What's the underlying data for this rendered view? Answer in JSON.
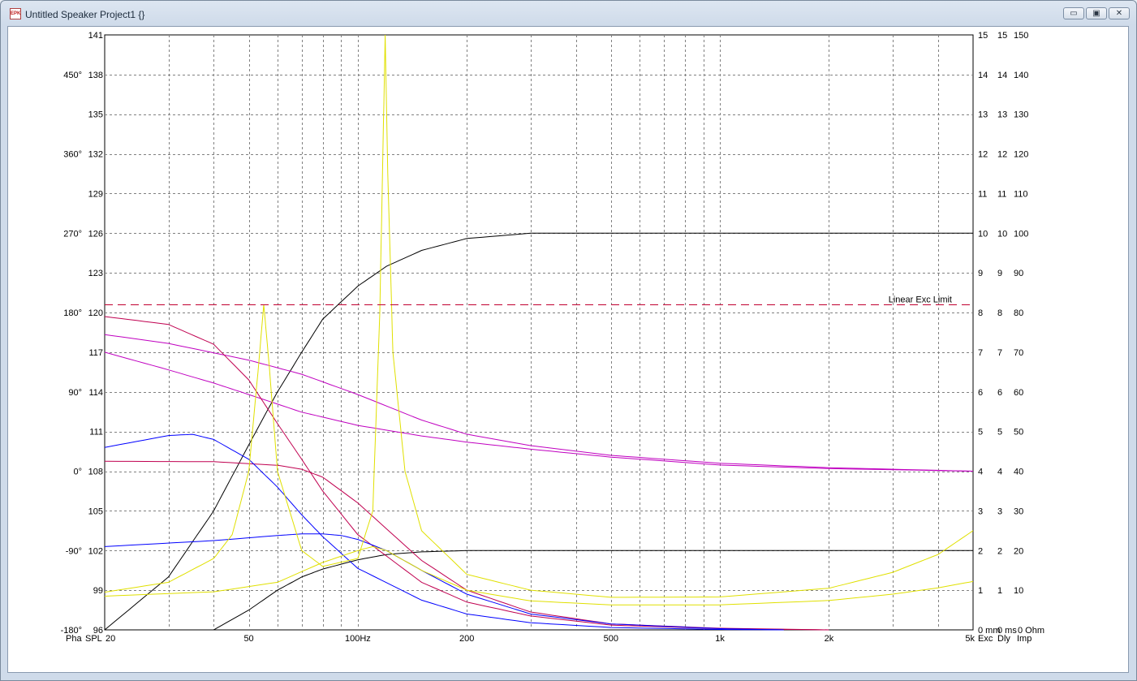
{
  "window": {
    "title": "Untitled Speaker Project1 {}",
    "app_icon_text": "EPK",
    "minimize_glyph": "▭",
    "maximize_glyph": "▣",
    "close_glyph": "✕"
  },
  "chart_data": {
    "type": "line",
    "x_axis": {
      "scale": "log",
      "range": [
        20,
        5000
      ],
      "tick_labels": [
        {
          "value": 20,
          "label": "20"
        },
        {
          "value": 50,
          "label": "50"
        },
        {
          "value": 100,
          "label": "100Hz"
        },
        {
          "value": 200,
          "label": "200"
        },
        {
          "value": 500,
          "label": "500"
        },
        {
          "value": 1000,
          "label": "1k"
        },
        {
          "value": 2000,
          "label": "2k"
        },
        {
          "value": 5000,
          "label": "5k"
        }
      ],
      "minor_gridlines": [
        30,
        40,
        60,
        70,
        80,
        90,
        300,
        400,
        600,
        700,
        800,
        900,
        3000,
        4000
      ]
    },
    "left_axes": {
      "phase_labels": [
        "450°",
        "360°",
        "270°",
        "180°",
        "90°",
        "0°",
        "-90°",
        "-180°"
      ],
      "spl_range": [
        96,
        141
      ],
      "spl_labels": [
        "141",
        "138",
        "135",
        "132",
        "129",
        "126",
        "123",
        "120",
        "117",
        "114",
        "111",
        "108",
        "105",
        "102",
        "99",
        "96"
      ]
    },
    "right_axes": {
      "excursion_labels": [
        "15",
        "14",
        "13",
        "12",
        "11",
        "10",
        "9",
        "8",
        "7",
        "6",
        "5",
        "4",
        "3",
        "2",
        "1",
        "0 mm"
      ],
      "delay_labels": [
        "15",
        "14",
        "13",
        "12",
        "11",
        "10",
        "9",
        "8",
        "7",
        "6",
        "5",
        "4",
        "3",
        "2",
        "1",
        "0 ms"
      ],
      "impedance_labels": [
        "150",
        "140",
        "130",
        "120",
        "110",
        "100",
        "90",
        "80",
        "70",
        "60",
        "50",
        "40",
        "30",
        "20",
        "10",
        "0 Ohm"
      ]
    },
    "legend": {
      "pha": {
        "label": "Pha",
        "color": "#c000c0"
      },
      "spl": {
        "label": "SPL",
        "color": "#000000"
      },
      "exc": {
        "label": "Exc",
        "color": "#c00050"
      },
      "dly": {
        "label": "Dly",
        "color": "#0000ff"
      },
      "imp": {
        "label": "Imp",
        "color": "#e0e000"
      }
    },
    "annotation": {
      "label": "Linear Exc Limit",
      "value_mm": 8.2,
      "color": "#c00030"
    },
    "series": [
      {
        "kind": "spl",
        "color": "#000000",
        "unit": "dB",
        "points": [
          [
            20,
            96
          ],
          [
            30,
            100
          ],
          [
            40,
            105
          ],
          [
            50,
            110
          ],
          [
            60,
            114
          ],
          [
            70,
            117
          ],
          [
            80,
            119.5
          ],
          [
            100,
            122
          ],
          [
            120,
            123.5
          ],
          [
            150,
            124.7
          ],
          [
            200,
            125.6
          ],
          [
            300,
            126
          ],
          [
            5000,
            126
          ]
        ]
      },
      {
        "kind": "spl",
        "color": "#000000",
        "unit": "dB",
        "points": [
          [
            40,
            96
          ],
          [
            50,
            97.5
          ],
          [
            60,
            99
          ],
          [
            70,
            100
          ],
          [
            80,
            100.6
          ],
          [
            100,
            101.3
          ],
          [
            120,
            101.7
          ],
          [
            150,
            101.9
          ],
          [
            200,
            102
          ],
          [
            5000,
            102
          ]
        ]
      },
      {
        "kind": "phase",
        "color": "#c000c0",
        "unit": "deg",
        "points": [
          [
            20,
            155
          ],
          [
            30,
            145
          ],
          [
            50,
            126
          ],
          [
            70,
            110
          ],
          [
            100,
            87
          ],
          [
            150,
            58
          ],
          [
            200,
            42
          ],
          [
            300,
            29
          ],
          [
            500,
            18
          ],
          [
            1000,
            9
          ],
          [
            2000,
            4
          ],
          [
            5000,
            0
          ]
        ]
      },
      {
        "kind": "phase",
        "color": "#c000c0",
        "unit": "deg",
        "points": [
          [
            20,
            135
          ],
          [
            30,
            115
          ],
          [
            40,
            100
          ],
          [
            50,
            87
          ],
          [
            70,
            67
          ],
          [
            100,
            52
          ],
          [
            150,
            40
          ],
          [
            200,
            33
          ],
          [
            300,
            25
          ],
          [
            500,
            16
          ],
          [
            1000,
            7
          ],
          [
            2000,
            3
          ],
          [
            5000,
            0
          ]
        ]
      },
      {
        "kind": "excursion",
        "color": "#c00050",
        "unit": "mm",
        "points": [
          [
            20,
            7.9
          ],
          [
            30,
            7.7
          ],
          [
            40,
            7.2
          ],
          [
            50,
            6.3
          ],
          [
            60,
            5.2
          ],
          [
            70,
            4.3
          ],
          [
            80,
            3.5
          ],
          [
            100,
            2.4
          ],
          [
            150,
            1.2
          ],
          [
            200,
            0.7
          ],
          [
            300,
            0.35
          ],
          [
            500,
            0.12
          ],
          [
            1000,
            0.03
          ],
          [
            2000,
            0
          ]
        ]
      },
      {
        "kind": "excursion",
        "color": "#c00050",
        "unit": "mm",
        "points": [
          [
            20,
            4.25
          ],
          [
            40,
            4.24
          ],
          [
            60,
            4.15
          ],
          [
            70,
            4.05
          ],
          [
            80,
            3.85
          ],
          [
            100,
            3.2
          ],
          [
            150,
            1.75
          ],
          [
            200,
            1.0
          ],
          [
            300,
            0.45
          ],
          [
            500,
            0.15
          ],
          [
            1000,
            0.04
          ],
          [
            2000,
            0
          ]
        ]
      },
      {
        "kind": "delay",
        "color": "#0000ff",
        "unit": "ms",
        "points": [
          [
            20,
            4.6
          ],
          [
            30,
            4.9
          ],
          [
            35,
            4.93
          ],
          [
            40,
            4.8
          ],
          [
            50,
            4.3
          ],
          [
            60,
            3.6
          ],
          [
            70,
            2.9
          ],
          [
            80,
            2.35
          ],
          [
            100,
            1.55
          ],
          [
            150,
            0.75
          ],
          [
            200,
            0.4
          ],
          [
            300,
            0.18
          ],
          [
            500,
            0.06
          ],
          [
            1000,
            0.01
          ],
          [
            1500,
            0
          ]
        ]
      },
      {
        "kind": "delay",
        "color": "#0000ff",
        "unit": "ms",
        "points": [
          [
            20,
            2.1
          ],
          [
            40,
            2.25
          ],
          [
            60,
            2.38
          ],
          [
            70,
            2.42
          ],
          [
            80,
            2.42
          ],
          [
            90,
            2.38
          ],
          [
            100,
            2.28
          ],
          [
            120,
            2.0
          ],
          [
            150,
            1.5
          ],
          [
            200,
            0.9
          ],
          [
            300,
            0.4
          ],
          [
            500,
            0.15
          ],
          [
            1000,
            0.03
          ],
          [
            1500,
            0
          ]
        ]
      },
      {
        "kind": "impedance",
        "color": "#e0e000",
        "unit": "ohm",
        "points": [
          [
            20,
            9.5
          ],
          [
            30,
            12
          ],
          [
            40,
            18
          ],
          [
            45,
            24
          ],
          [
            50,
            40
          ],
          [
            53,
            65
          ],
          [
            55,
            82
          ],
          [
            57,
            66
          ],
          [
            60,
            40
          ],
          [
            70,
            20
          ],
          [
            80,
            16
          ],
          [
            100,
            18
          ],
          [
            110,
            30
          ],
          [
            115,
            80
          ],
          [
            117,
            115
          ],
          [
            119,
            150
          ],
          [
            121,
            115
          ],
          [
            125,
            70
          ],
          [
            135,
            40
          ],
          [
            150,
            25
          ],
          [
            200,
            14
          ],
          [
            300,
            10
          ],
          [
            500,
            8.2
          ],
          [
            1000,
            8.3
          ],
          [
            2000,
            10.5
          ],
          [
            3000,
            14.5
          ],
          [
            4000,
            19
          ],
          [
            5000,
            25
          ]
        ]
      },
      {
        "kind": "impedance",
        "color": "#e0e000",
        "unit": "ohm",
        "points": [
          [
            20,
            8.5
          ],
          [
            40,
            9.6
          ],
          [
            60,
            12
          ],
          [
            80,
            17
          ],
          [
            100,
            20
          ],
          [
            110,
            21
          ],
          [
            120,
            20
          ],
          [
            150,
            15
          ],
          [
            200,
            10
          ],
          [
            300,
            7.3
          ],
          [
            500,
            6.3
          ],
          [
            1000,
            6.3
          ],
          [
            2000,
            7.4
          ],
          [
            3000,
            9
          ],
          [
            4000,
            10.6
          ],
          [
            5000,
            12.2
          ]
        ]
      }
    ]
  }
}
